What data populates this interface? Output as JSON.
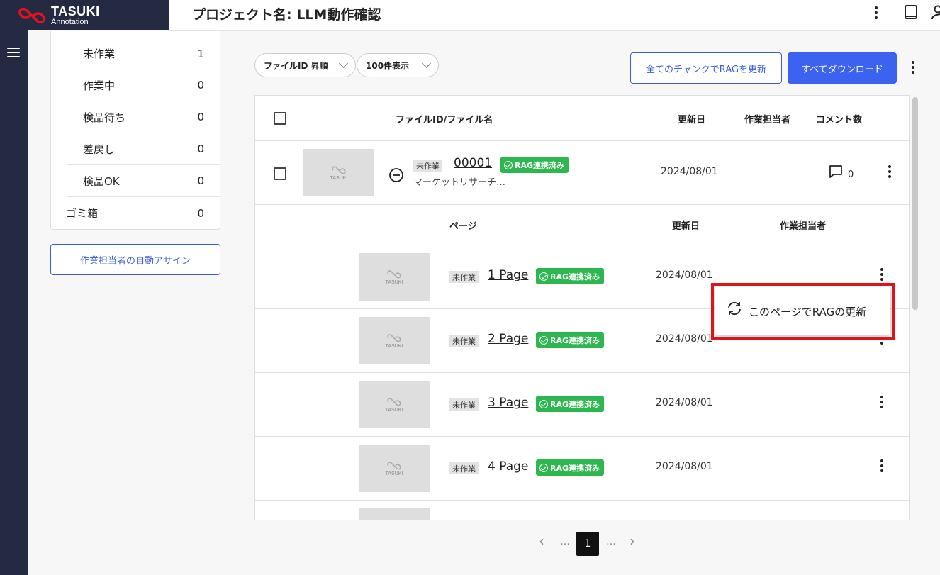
{
  "brand": {
    "name": "TASUKI",
    "sub": "Annotation",
    "colors": {
      "sidebar": "#232a42",
      "accent": "#3b63f0",
      "rag_badge": "#2db84f",
      "highlight": "#e0121b"
    }
  },
  "header": {
    "title": "プロジェクト名: LLM動作確認",
    "icons": [
      "kebab-icon",
      "book-icon",
      "user-icon"
    ]
  },
  "status_counts": [
    {
      "label": "未作業",
      "count": "1"
    },
    {
      "label": "作業中",
      "count": "0"
    },
    {
      "label": "検品待ち",
      "count": "0"
    },
    {
      "label": "差戻し",
      "count": "0"
    },
    {
      "label": "検品OK",
      "count": "0"
    }
  ],
  "trash": {
    "label": "ゴミ箱",
    "count": "0"
  },
  "auto_assign_label": "作業担当者の自動アサイン",
  "toolbar": {
    "sort_label": "ファイルID 昇順",
    "per_page_label": "100件表示",
    "update_all_label": "全てのチャンクでRAGを更新",
    "download_all_label": "すべてダウンロード"
  },
  "table": {
    "headers": {
      "file": "ファイルID/ファイル名",
      "updated": "更新日",
      "assignee": "作業担当者",
      "comments": "コメント数"
    },
    "file": {
      "status": "未作業",
      "id": "00001",
      "rag": "RAG連携済み",
      "name": "マーケットリサーチ…",
      "date": "2024/08/01",
      "comments": "0"
    },
    "page_headers": {
      "page": "ページ",
      "updated": "更新日",
      "assignee": "作業担当者"
    },
    "pages": [
      {
        "status": "未作業",
        "label": "1 Page",
        "rag": "RAG連携済み",
        "date": "2024/08/01"
      },
      {
        "status": "未作業",
        "label": "2 Page",
        "rag": "RAG連携済み",
        "date": "2024/08/01"
      },
      {
        "status": "未作業",
        "label": "3 Page",
        "rag": "RAG連携済み",
        "date": "2024/08/01"
      },
      {
        "status": "未作業",
        "label": "4 Page",
        "rag": "RAG連携済み",
        "date": "2024/08/01"
      }
    ],
    "thumbnail_label": "TASUKI"
  },
  "popup_menu": {
    "item": "このページでRAGの更新"
  },
  "pagination": {
    "prev": "‹",
    "ellipsis": "…",
    "current": "1",
    "next": "›"
  }
}
